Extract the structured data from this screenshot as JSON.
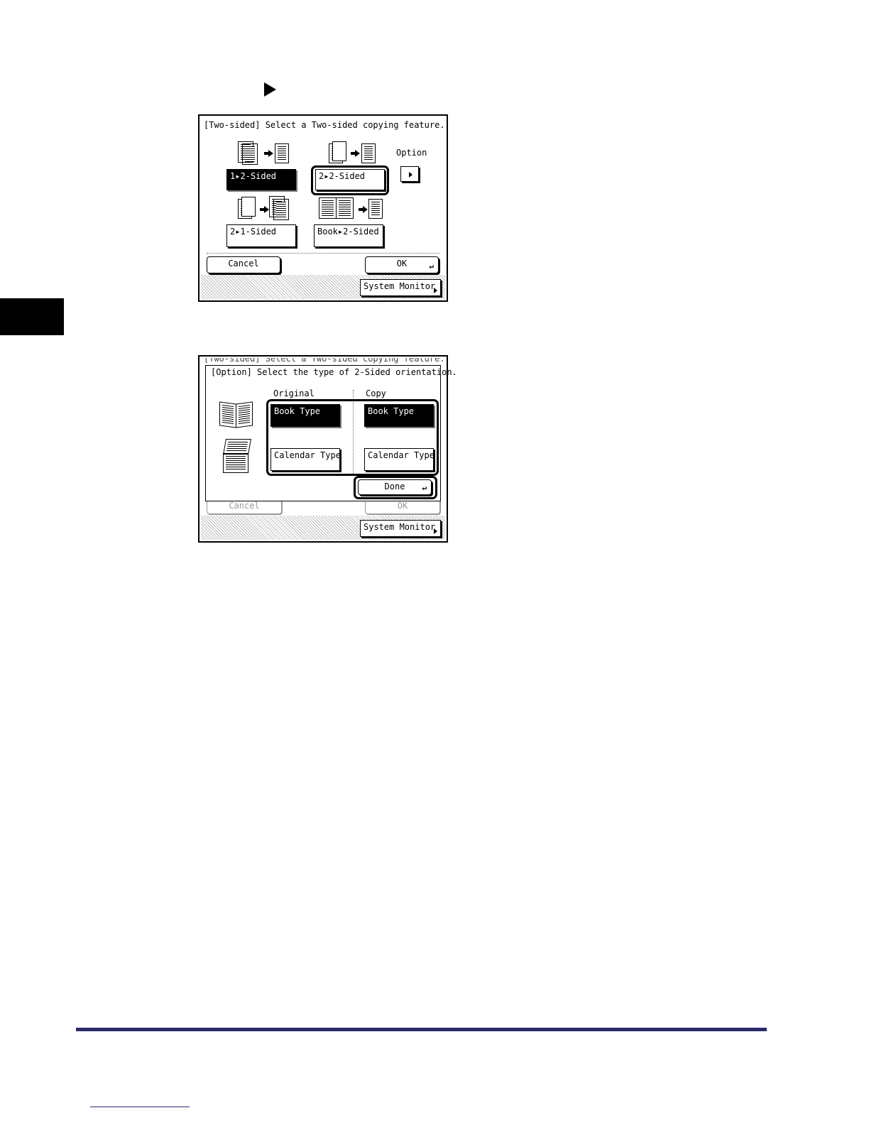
{
  "screen1": {
    "message": "[Two-sided] Select a Two-sided copying feature.",
    "option_label": "Option",
    "buttons": {
      "one_to_two": "1▸2-Sided",
      "two_to_two": "2▸2-Sided",
      "two_to_one": "2▸1-Sided",
      "book_to_two": "Book▸2-Sided"
    },
    "cancel": "Cancel",
    "ok": "OK",
    "system_monitor": "System Monitor"
  },
  "screen2": {
    "behind_message": "[Two-sided] Select a Two-sided copying feature.",
    "message": "[Option] Select the type of 2-Sided orientation.",
    "original_label": "Original",
    "copy_label": "Copy",
    "original_book": "Book Type",
    "original_calendar": "Calendar Type",
    "copy_book": "Book Type",
    "copy_calendar": "Calendar Type",
    "done": "Done",
    "cancel": "Cancel",
    "ok": "OK",
    "system_monitor": "System Monitor"
  },
  "icons": {
    "return_glyph": "↵"
  }
}
